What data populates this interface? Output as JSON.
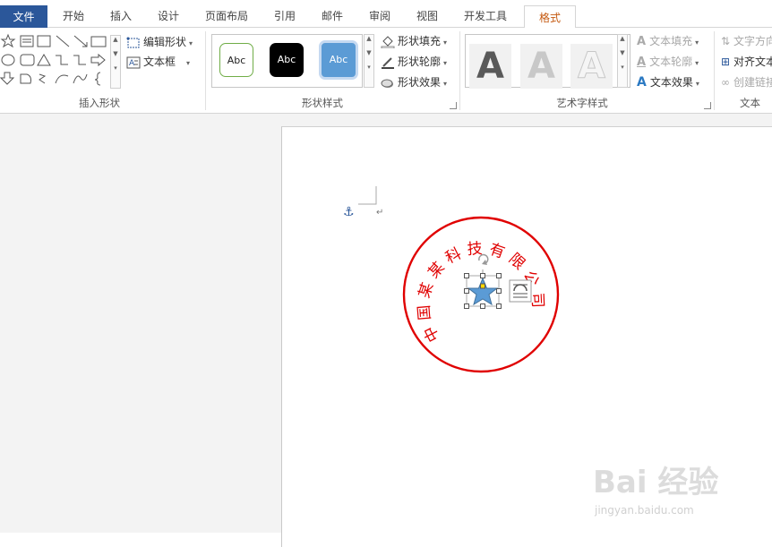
{
  "tabs": [
    {
      "label": "文件"
    },
    {
      "label": "开始"
    },
    {
      "label": "插入"
    },
    {
      "label": "设计"
    },
    {
      "label": "页面布局"
    },
    {
      "label": "引用"
    },
    {
      "label": "邮件"
    },
    {
      "label": "审阅"
    },
    {
      "label": "视图"
    },
    {
      "label": "开发工具"
    },
    {
      "label": "格式"
    }
  ],
  "groups": {
    "insert_shapes": {
      "label": "插入形状",
      "edit_shape": "编辑形状",
      "text_box": "文本框"
    },
    "shape_styles": {
      "label": "形状样式",
      "styles": [
        {
          "text": "Abc"
        },
        {
          "text": "Abc"
        },
        {
          "text": "Abc"
        }
      ],
      "fill": "形状填充",
      "outline": "形状轮廓",
      "effects": "形状效果"
    },
    "wordart_styles": {
      "label": "艺术字样式",
      "letters": [
        "A",
        "A",
        "A"
      ],
      "text_fill": "文本填充",
      "text_outline": "文本轮廓",
      "text_effects": "文本效果"
    },
    "text": {
      "label": "文本",
      "direction": "文字方向",
      "align": "对齐文本",
      "link": "创建链接"
    }
  },
  "stamp": {
    "text": "中国某某科技有限公司",
    "color": "#e00000",
    "star_color": "#5b9bd5"
  },
  "colors": {
    "file_tab": "#2b579a",
    "active_tab_text": "#c55a11"
  },
  "watermark": {
    "brand": "Bai 经验",
    "url": "jingyan.baidu.com"
  }
}
